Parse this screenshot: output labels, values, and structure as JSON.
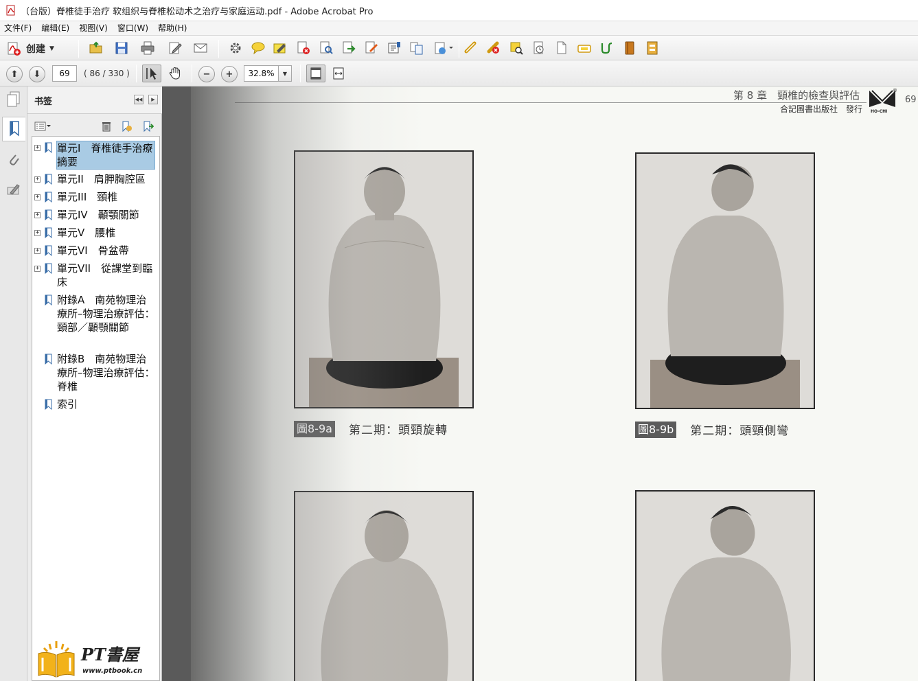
{
  "window": {
    "title": "（台版）脊椎徒手治疗 软组织与脊椎松动术之治疗与家庭运动.pdf - Adobe Acrobat Pro"
  },
  "menu": [
    "文件(F)",
    "编辑(E)",
    "视图(V)",
    "窗口(W)",
    "帮助(H)"
  ],
  "toolbar": {
    "create_label": "创建",
    "icons": [
      "open-icon",
      "save-icon",
      "print-icon",
      "edit-icon",
      "email-icon",
      "settings-icon",
      "comment-icon",
      "highlight-icon",
      "delete-page-icon",
      "search-doc-icon",
      "export-icon",
      "sign-icon",
      "form-icon",
      "combine-icon",
      "share-icon",
      "link-icon",
      "unlink-icon",
      "review-icon",
      "properties-icon",
      "page-icon",
      "camera-icon",
      "path-icon",
      "book-icon",
      "stamp-icon"
    ]
  },
  "navigation": {
    "current_page": "69",
    "page_count": "( 86 / 330 )",
    "zoom": "32.8%"
  },
  "bookmarks": {
    "title": "书签",
    "items": [
      {
        "label": "單元I　脊椎徒手治療摘要",
        "expandable": true,
        "selected": true
      },
      {
        "label": "單元II　肩胛胸腔區",
        "expandable": true,
        "selected": false
      },
      {
        "label": "單元III　頸椎",
        "expandable": true,
        "selected": false
      },
      {
        "label": "單元IV　顳顎關節",
        "expandable": true,
        "selected": false
      },
      {
        "label": "單元V　腰椎",
        "expandable": true,
        "selected": false
      },
      {
        "label": "單元VI　骨盆帶",
        "expandable": true,
        "selected": false
      },
      {
        "label": "單元VII　從課堂到臨床",
        "expandable": true,
        "selected": false
      },
      {
        "label": "附錄A　南苑物理治療所–物理治療評估：頸部／顳顎關節",
        "expandable": false,
        "selected": false
      },
      {
        "label": "附錄B　南苑物理治療所–物理治療評估：脊椎",
        "expandable": false,
        "selected": false
      },
      {
        "label": "索引",
        "expandable": false,
        "selected": false
      }
    ]
  },
  "document": {
    "running_title": "第 8 章　頸椎的檢查與評估",
    "publisher": "合記圖書出版社　發行",
    "page_number": "69",
    "logo_text": "HO-CHI",
    "figures": [
      {
        "tag": "圖8-9a",
        "caption": "第二期：頭頸旋轉"
      },
      {
        "tag": "圖8-9b",
        "caption": "第二期：頭頸側彎"
      }
    ]
  },
  "watermark": {
    "title": "PT書屋",
    "url": "www.ptbook.cn"
  },
  "colors": {
    "selection": "#a9cbe4",
    "doc_background": "#5a5a5a",
    "page": "#f7f8f4"
  }
}
